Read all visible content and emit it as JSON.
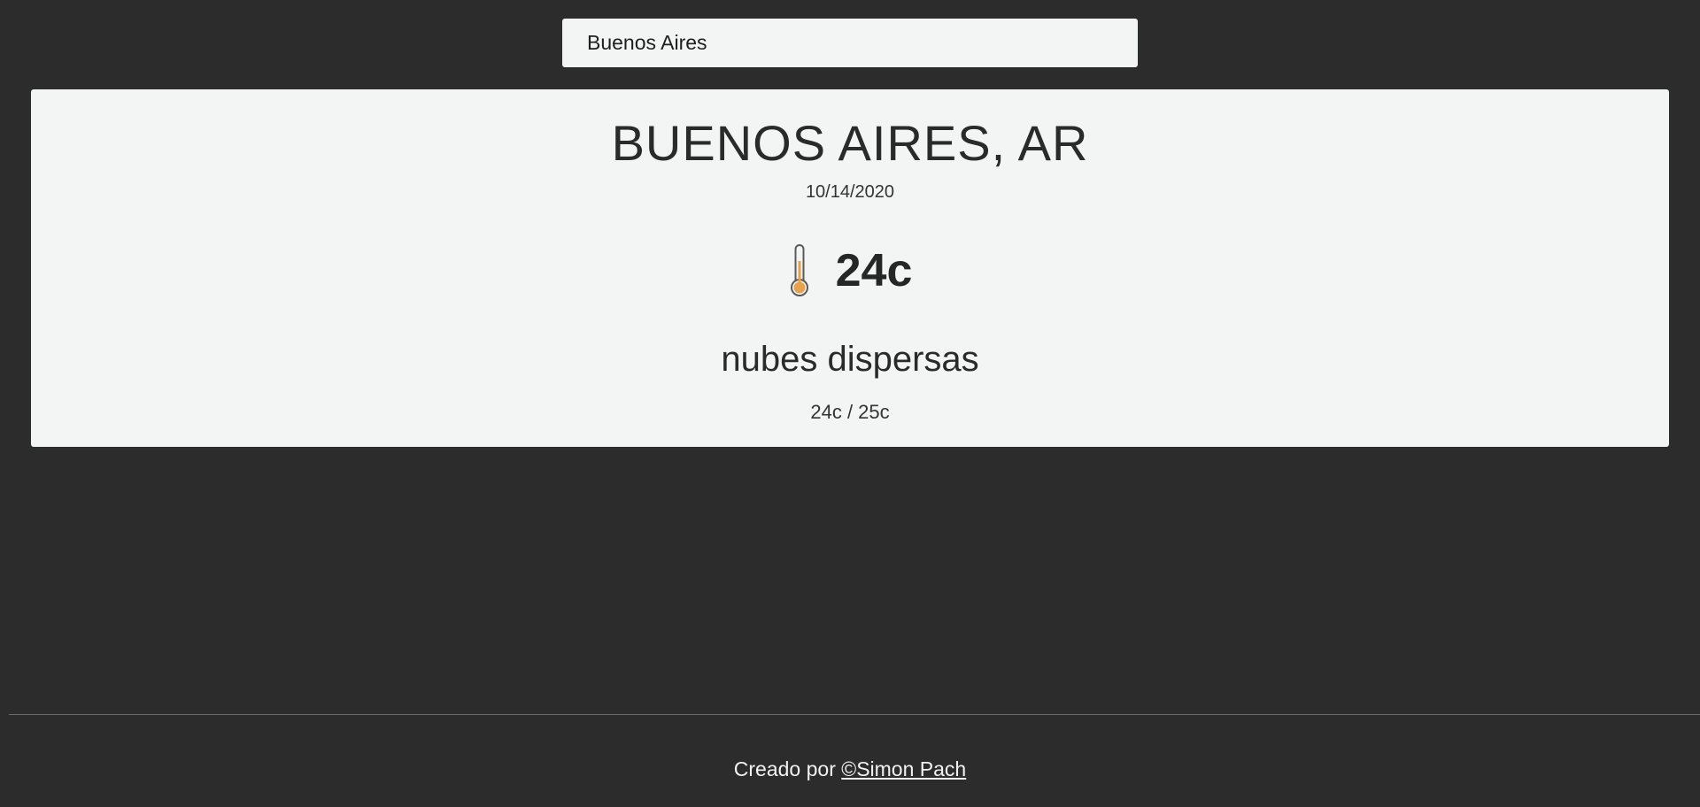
{
  "search": {
    "value": "Buenos Aires",
    "placeholder": ""
  },
  "weather": {
    "city": "BUENOS AIRES, AR",
    "date": "10/14/2020",
    "temperature": "24c",
    "description": "nubes dispersas",
    "min_max": "24c / 25c",
    "icon": "thermometer-icon"
  },
  "footer": {
    "prefix": "Creado por",
    "author_link": "©Simon Pach"
  },
  "colors": {
    "background": "#2c2c2c",
    "card": "#f3f5f4",
    "thermometer_fill": "#e8a34a"
  }
}
